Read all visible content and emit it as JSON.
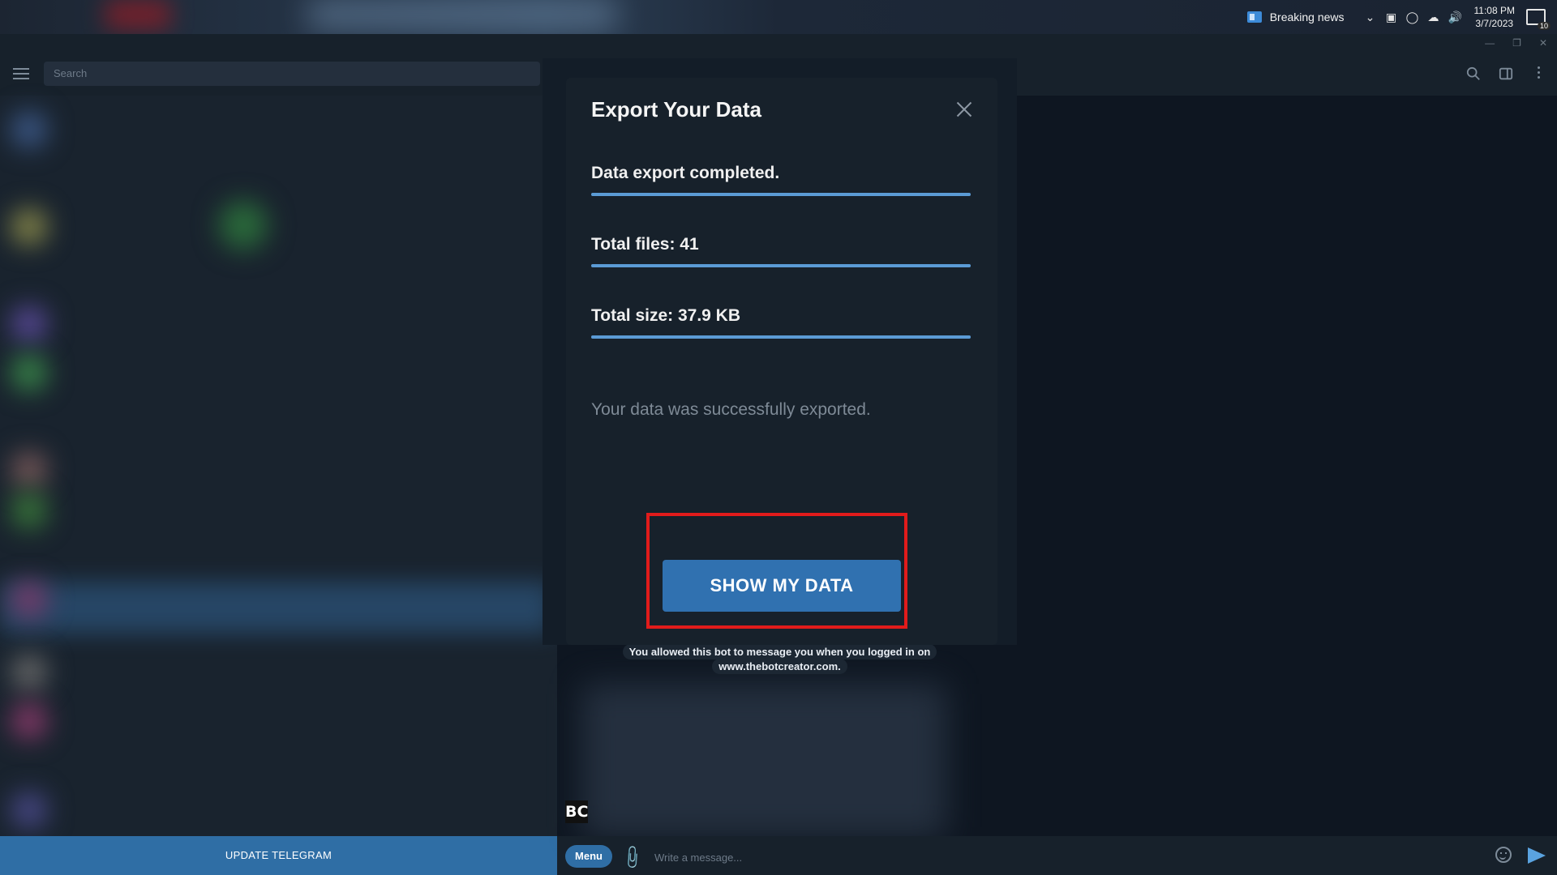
{
  "taskbar": {
    "news_label": "Breaking news",
    "time": "11:08 PM",
    "date": "3/7/2023",
    "notifications_count": "10",
    "tray_icons": [
      "chevron-up-icon",
      "network-icon",
      "meet-icon",
      "onedrive-icon",
      "volume-icon"
    ]
  },
  "sidebar": {
    "search_placeholder": "Search",
    "update_label": "UPDATE TELEGRAM"
  },
  "dialog": {
    "title": "Export Your Data",
    "stats": [
      {
        "label": "Data export completed.",
        "progress": 1.0
      },
      {
        "label": "Total files: 41",
        "progress": 1.0
      },
      {
        "label": "Total size: 37.9 KB",
        "progress": 1.0
      }
    ],
    "message": "Your data was successfully exported.",
    "button_label": "SHOW MY DATA"
  },
  "chat": {
    "service_message": "You allowed this bot to message you when you logged in on www.thebotcreator.com.",
    "bot_avatar_text": "BC",
    "menu_label": "Menu",
    "input_placeholder": "Write a message..."
  },
  "colors": {
    "accent": "#3071b0",
    "highlight": "#e11b1b",
    "progress": "#5b9bd5",
    "background": "#0e1621"
  }
}
